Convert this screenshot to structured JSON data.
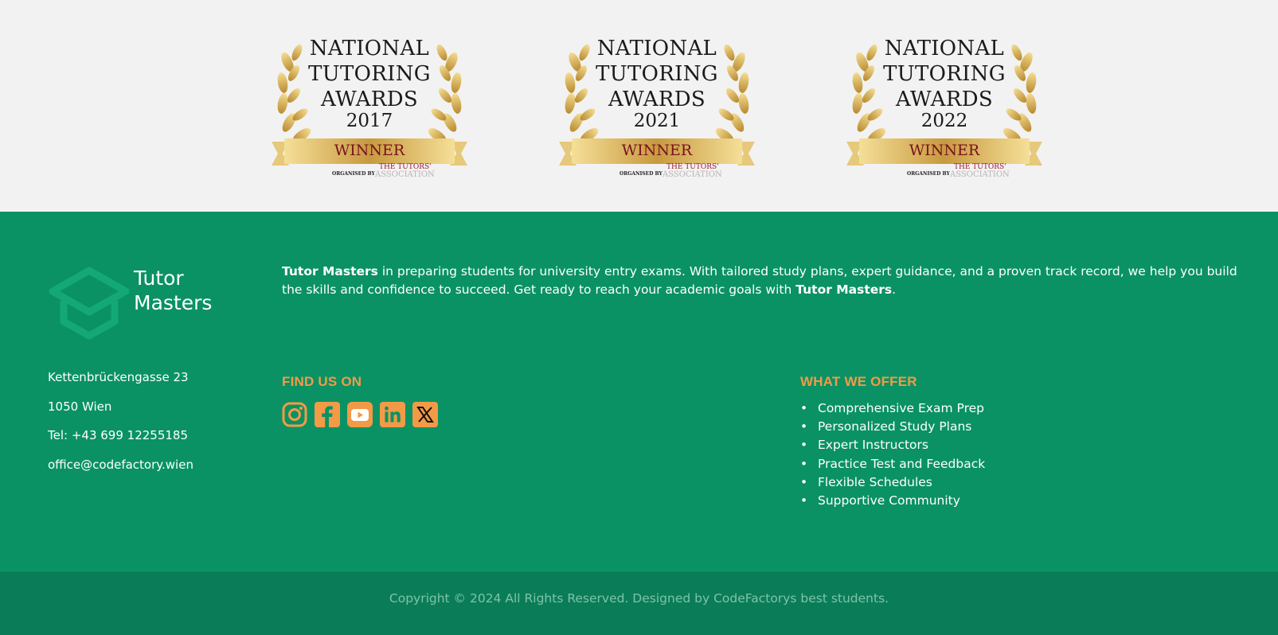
{
  "awards": [
    {
      "line1": "NATIONAL",
      "line2": "TUTORING",
      "line3": "AWARDS",
      "year": "2017",
      "ribbon": "WINNER",
      "organised_by": "ORGANISED BY",
      "org_name_1": "THE TUTORS'",
      "org_name_2": "ASSOCIATION"
    },
    {
      "line1": "NATIONAL",
      "line2": "TUTORING",
      "line3": "AWARDS",
      "year": "2021",
      "ribbon": "WINNER",
      "organised_by": "ORGANISED BY",
      "org_name_1": "THE TUTORS'",
      "org_name_2": "ASSOCIATION"
    },
    {
      "line1": "NATIONAL",
      "line2": "TUTORING",
      "line3": "AWARDS",
      "year": "2022",
      "ribbon": "WINNER",
      "organised_by": "ORGANISED BY",
      "org_name_1": "THE TUTORS'",
      "org_name_2": "ASSOCIATION"
    }
  ],
  "footer": {
    "logo": {
      "line1": "Tutor",
      "line2": "Masters"
    },
    "about": {
      "brand_start": "Tutor Masters",
      "text_middle": " in preparing students for university entry exams. With tailored study plans, expert guidance, and a proven track record, we help you build the skills and confidence to succeed. Get ready to reach your academic goals with ",
      "brand_end": "Tutor Masters",
      "text_end": "."
    },
    "contact": {
      "street": "Kettenbrückengasse 23",
      "city": "1050 Wien",
      "phone": "Tel: +43 699 12255185",
      "email": "office@codefactory.wien"
    },
    "find_us": {
      "title": "FIND US ON",
      "socials": [
        "instagram-icon",
        "facebook-icon",
        "youtube-icon",
        "linkedin-icon",
        "x-icon"
      ]
    },
    "offer": {
      "title": "WHAT WE OFFER",
      "items": [
        "Comprehensive Exam Prep",
        "Personalized Study Plans",
        "Expert Instructors",
        "Practice Test and Feedback",
        "Flexible Schedules",
        "Supportive Community"
      ]
    },
    "copyright": "Copyright © 2024 All Rights Reserved. Designed by CodeFactorys best students."
  },
  "colors": {
    "footer_bg": "#0a9264",
    "copyright_bg": "#0a7d58",
    "accent_orange": "#f39a47",
    "gold": "#c9a040",
    "ribbon_text": "#7a1020"
  }
}
